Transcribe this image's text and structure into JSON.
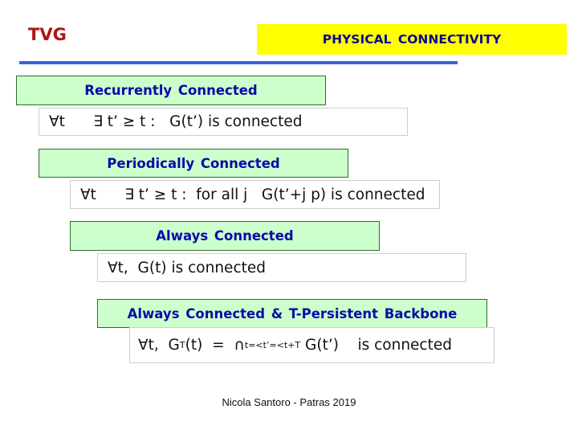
{
  "slide": {
    "header": {
      "label": "TVG",
      "title": "PHYSICAL  CONNECTIVITY",
      "label_color": "#b01414",
      "title_bg": "#ffff00",
      "title_color": "#0a0a8c",
      "rule_color": "#3b65db"
    },
    "blocks": [
      {
        "heading": "Recurrently  Connected",
        "formula": {
          "quantifier": "∀",
          "rest": "t      ∃ t’ ≥ t :   G(t’) is connected"
        }
      },
      {
        "heading": "Periodically  Connected",
        "formula": {
          "quantifier": "∀",
          "rest": "t      ∃ t’ ≥ t :  for all j   G(t’+j p) is connected"
        }
      },
      {
        "heading": "Always  Connected",
        "formula": {
          "quantifier": "∀",
          "rest": "t,  G(t) is connected"
        }
      },
      {
        "heading": "Always  Connected &  T-Persistent Backbone",
        "formula": {
          "quantifier": "∀",
          "part1": "t,  G",
          "sub1": "T",
          "part2": "(t)  =  ",
          "intersect": "∩",
          "sub2": "t=<t’=<t+T",
          "part3": " G(t’)    is connected"
        }
      }
    ],
    "colors": {
      "heading_bg": "#ccffcc",
      "heading_border": "#2e6b2e",
      "heading_text": "#0b0ba8",
      "formula_border": "#cfcfcf"
    },
    "footer": "Nicola Santoro - Patras 2019"
  }
}
